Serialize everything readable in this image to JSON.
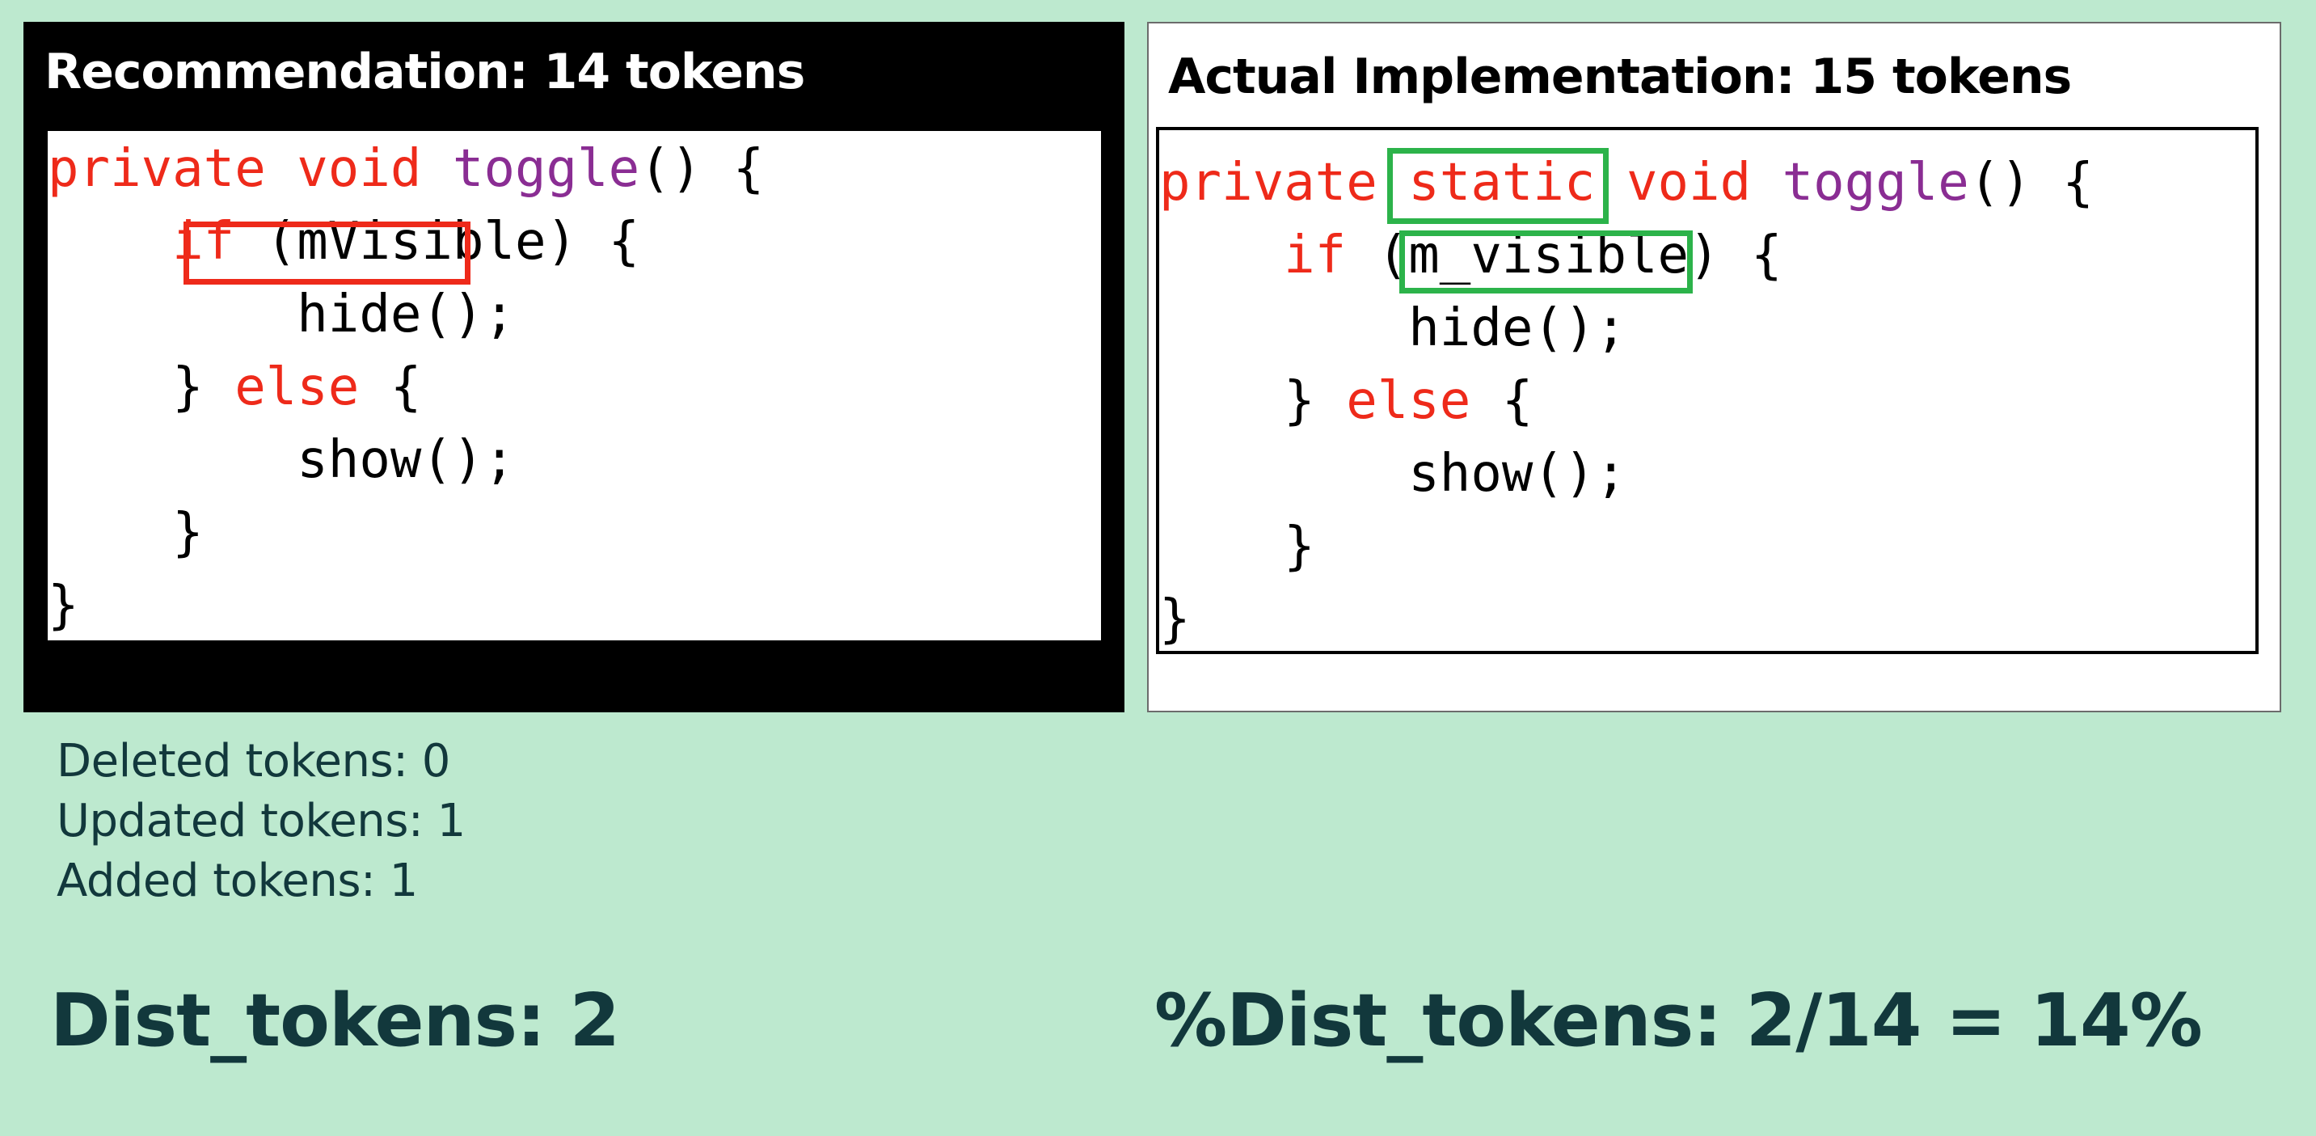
{
  "recommendation": {
    "title": "Recommendation: 14 tokens",
    "code": [
      [
        {
          "t": "private",
          "k": "kw"
        },
        {
          "t": " "
        },
        {
          "t": "void",
          "k": "kw"
        },
        {
          "t": " "
        },
        {
          "t": "toggle",
          "k": "fn"
        },
        {
          "t": "() {"
        }
      ],
      [
        {
          "t": "    "
        },
        {
          "t": "if",
          "k": "kw"
        },
        {
          "t": " (mVisible) {"
        }
      ],
      [
        {
          "t": "        hide();"
        }
      ],
      [
        {
          "t": "    } "
        },
        {
          "t": "else",
          "k": "kw"
        },
        {
          "t": " {"
        }
      ],
      [
        {
          "t": "        show();"
        }
      ],
      [
        {
          "t": "    }"
        }
      ],
      [
        {
          "t": "}"
        }
      ]
    ]
  },
  "actual": {
    "title": "Actual Implementation: 15 tokens",
    "code": [
      [
        {
          "t": "private",
          "k": "kw"
        },
        {
          "t": " "
        },
        {
          "t": "static",
          "k": "kw"
        },
        {
          "t": " "
        },
        {
          "t": "void",
          "k": "kw"
        },
        {
          "t": " "
        },
        {
          "t": "toggle",
          "k": "fn"
        },
        {
          "t": "() {"
        }
      ],
      [
        {
          "t": "    "
        },
        {
          "t": "if",
          "k": "kw"
        },
        {
          "t": " (m_visible) {"
        }
      ],
      [
        {
          "t": "        hide();"
        }
      ],
      [
        {
          "t": "    } "
        },
        {
          "t": "else",
          "k": "kw"
        },
        {
          "t": " {"
        }
      ],
      [
        {
          "t": "        show();"
        }
      ],
      [
        {
          "t": "    }"
        }
      ],
      [
        {
          "t": "}"
        }
      ]
    ]
  },
  "highlights": {
    "updated_color": "#ee2a1a",
    "added_color": "#2cb34a"
  },
  "stats": {
    "deleted": "Deleted tokens: 0",
    "updated": "Updated tokens: 1",
    "added": "Added tokens: 1"
  },
  "dist_tokens": "Dist_tokens: 2",
  "pct_dist_tokens": "%Dist_tokens: 2/14 = 14%"
}
